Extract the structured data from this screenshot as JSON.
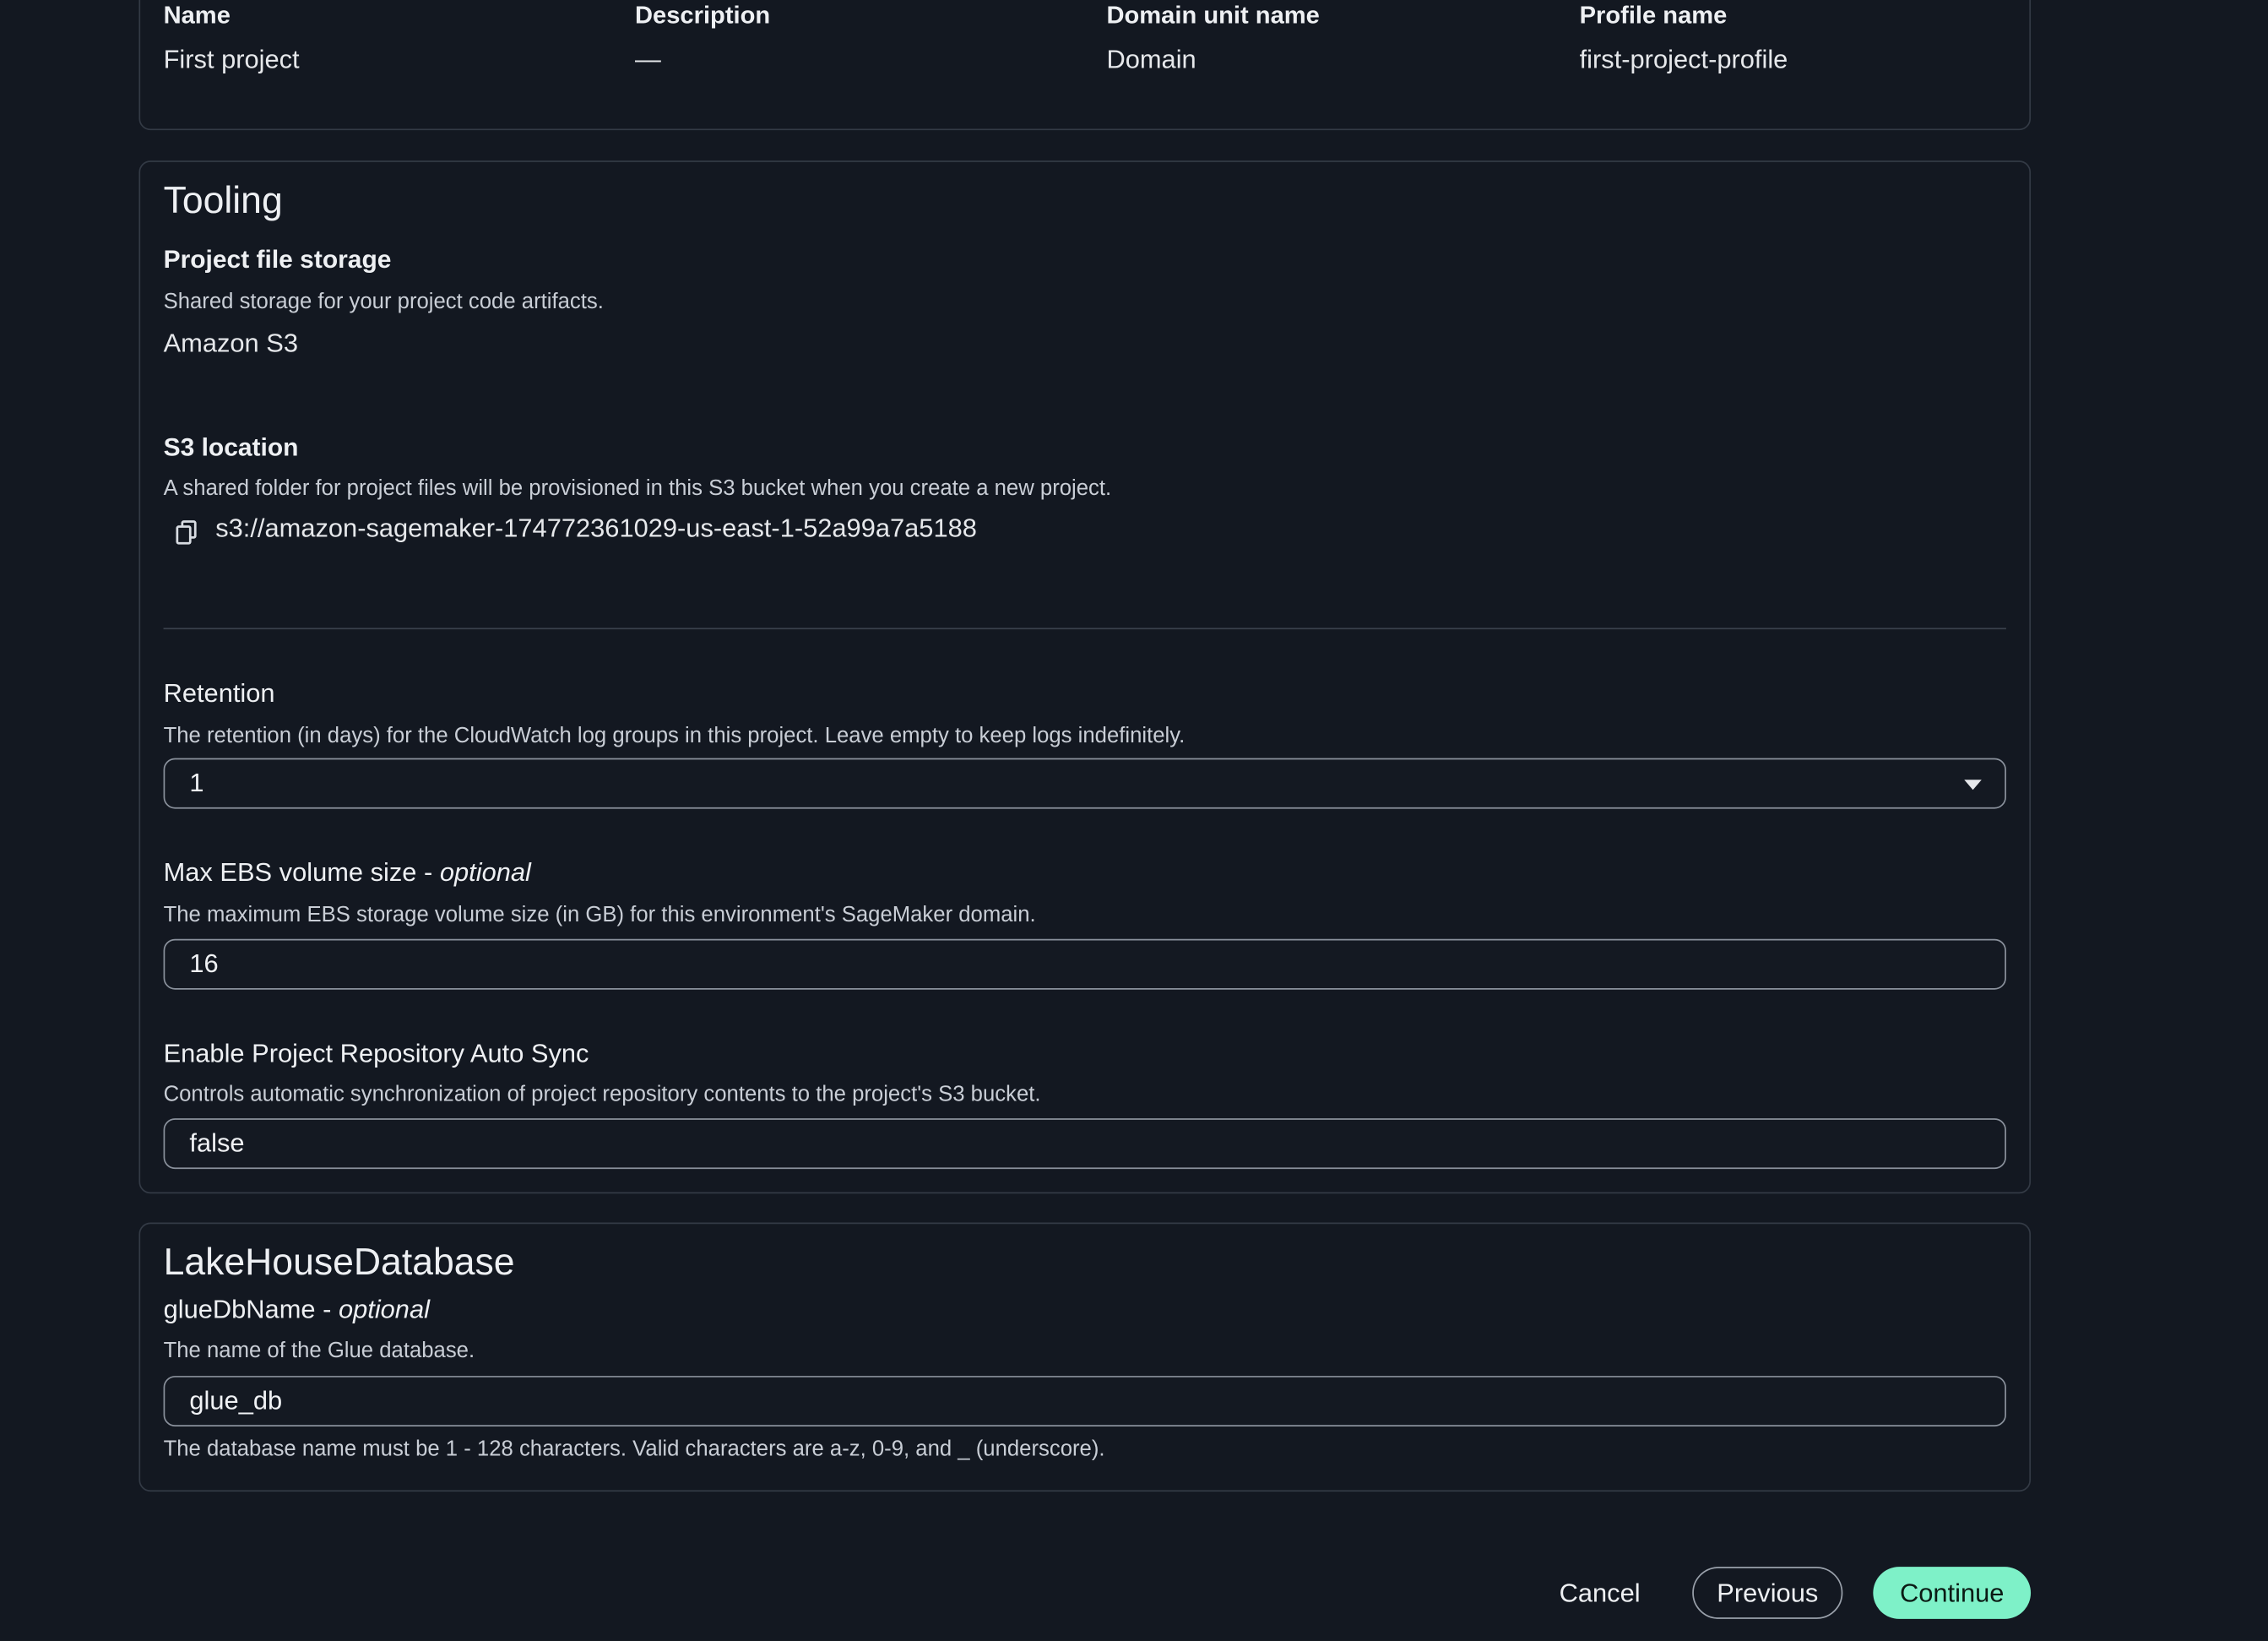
{
  "summary": {
    "columns": [
      {
        "key": "Name",
        "value": "First project"
      },
      {
        "key": "Description",
        "value": "—"
      },
      {
        "key": "Domain unit name",
        "value": "Domain"
      },
      {
        "key": "Profile name",
        "value": "first-project-profile"
      }
    ]
  },
  "tooling": {
    "title": "Tooling",
    "file_storage_label": "Project file storage",
    "file_storage_desc": "Shared storage for your project code artifacts.",
    "file_storage_value": "Amazon S3",
    "s3_label": "S3 location",
    "s3_desc": "A shared folder for project files will be provisioned in this S3 bucket when you create a new project.",
    "s3_value": "s3://amazon-sagemaker-174772361029-us-east-1-52a99a7a5188",
    "retention_label": "Retention",
    "retention_desc": "The retention (in days) for the CloudWatch log groups in this project. Leave empty to keep logs indefinitely.",
    "retention_value": "1",
    "ebs_label": "Max EBS volume size - ",
    "ebs_optional": "optional",
    "ebs_desc": "The maximum EBS storage volume size (in GB) for this environment's SageMaker domain.",
    "ebs_value": "16",
    "autosync_label": "Enable Project Repository Auto Sync",
    "autosync_desc": "Controls automatic synchronization of project repository contents to the project's S3 bucket.",
    "autosync_value": "false"
  },
  "lakehouse": {
    "title": "LakeHouseDatabase",
    "glue_label": "glueDbName - ",
    "glue_optional": "optional",
    "glue_desc": "The name of the Glue database.",
    "glue_value": "glue_db",
    "glue_constraint": "The database name must be 1 - 128 characters. Valid characters are a-z, 0-9, and _ (underscore)."
  },
  "footer": {
    "cancel_label": "Cancel",
    "previous_label": "Previous",
    "continue_label": "Continue"
  },
  "icons": {
    "copy": "copy-icon",
    "dropdown": "caret-down-icon"
  },
  "colors": {
    "background": "#131821",
    "accent": "#7ef1c8"
  }
}
